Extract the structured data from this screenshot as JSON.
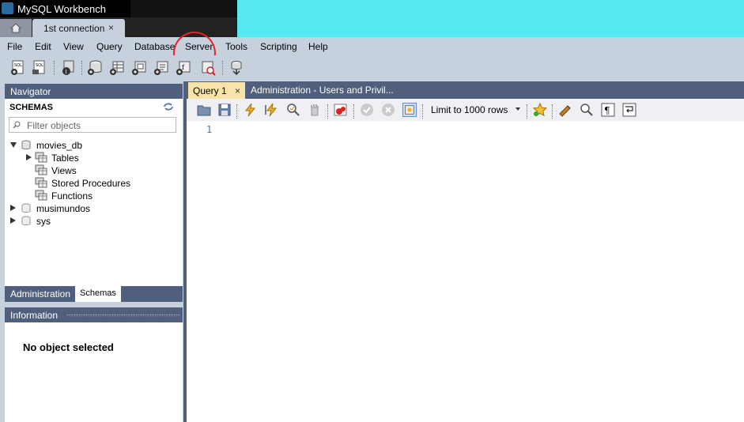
{
  "window": {
    "title": "MySQL Workbench"
  },
  "tabs": {
    "home": "home",
    "connection": {
      "label": "1st connection",
      "close": "×"
    }
  },
  "menu": [
    "File",
    "Edit",
    "View",
    "Query",
    "Database",
    "Server",
    "Tools",
    "Scripting",
    "Help"
  ],
  "annotation": {
    "color": "#e8202a",
    "target": "Server"
  },
  "navigator": {
    "header": "Navigator",
    "schemas_title": "SCHEMAS",
    "filter_placeholder": "Filter objects",
    "tree": {
      "movies_db": {
        "label": "movies_db",
        "children": [
          "Tables",
          "Views",
          "Stored Procedures",
          "Functions"
        ]
      },
      "others": [
        "musimundos",
        "sys"
      ]
    },
    "bottom_tabs": [
      "Administration",
      "Schemas"
    ]
  },
  "information": {
    "header": "Information",
    "message": "No object selected"
  },
  "editor": {
    "tabs": [
      {
        "label": "Query 1",
        "close": "×"
      },
      {
        "label": "Administration - Users and Privil..."
      }
    ],
    "limit_select": "Limit to 1000 rows",
    "line_number": "1"
  },
  "colors": {
    "panel_header": "#4f5f7c",
    "active_query_tab": "#f8e4a8",
    "chrome": "#c7d1de"
  }
}
